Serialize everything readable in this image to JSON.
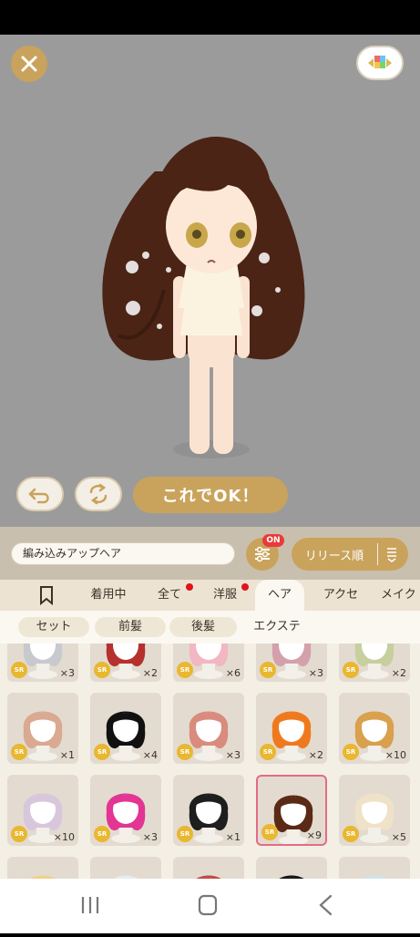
{
  "search": {
    "value": "編み込みアップヘア"
  },
  "filter": {
    "badge": "ON"
  },
  "sort": {
    "label": "リリース順"
  },
  "ok_button": {
    "label": "これでOK！"
  },
  "tabs": [
    {
      "label": "着用中"
    },
    {
      "label": "全て"
    },
    {
      "label": "洋服"
    },
    {
      "label": "ヘア"
    },
    {
      "label": "アクセ"
    },
    {
      "label": "メイク"
    }
  ],
  "subtabs": [
    {
      "label": "セット"
    },
    {
      "label": "前髪"
    },
    {
      "label": "後髪"
    },
    {
      "label": "エクステ"
    }
  ],
  "items": [
    {
      "rarity": "SR",
      "count": "×3",
      "color": "#c7c9cf"
    },
    {
      "rarity": "SR",
      "count": "×2",
      "color": "#b5312f"
    },
    {
      "rarity": "SR",
      "count": "×6",
      "color": "#f2b7c2"
    },
    {
      "rarity": "SR",
      "count": "×3",
      "color": "#d4a0ab"
    },
    {
      "rarity": "SR",
      "count": "×2",
      "color": "#c7cf9e"
    },
    {
      "rarity": "SR",
      "count": "×1",
      "color": "#d9a991"
    },
    {
      "rarity": "SR",
      "count": "×4",
      "color": "#111111"
    },
    {
      "rarity": "SR",
      "count": "×3",
      "color": "#d98c7e"
    },
    {
      "rarity": "SR",
      "count": "×2",
      "color": "#ef7a1e"
    },
    {
      "rarity": "SR",
      "count": "×10",
      "color": "#d9a04e"
    },
    {
      "rarity": "SR",
      "count": "×10",
      "color": "#d8c6dc"
    },
    {
      "rarity": "SR",
      "count": "×3",
      "color": "#e23594"
    },
    {
      "rarity": "SR",
      "count": "×1",
      "color": "#1e1e1e"
    },
    {
      "rarity": "SR",
      "count": "×9",
      "color": "#5a2a16"
    },
    {
      "rarity": "SR",
      "count": "×5",
      "color": "#efe2c8"
    },
    {
      "rarity": "",
      "count": "",
      "color": "#f0d08a"
    },
    {
      "rarity": "",
      "count": "",
      "color": "#e6ecef"
    },
    {
      "rarity": "",
      "count": "",
      "color": "#c24a42"
    },
    {
      "rarity": "",
      "count": "",
      "color": "#151515"
    },
    {
      "rarity": "",
      "count": "",
      "color": "#cfe3ea"
    }
  ],
  "colors": {
    "accent": "#c9a35c",
    "stage_bg": "#9b9b9b",
    "badge_red": "#e83b3b",
    "selected_border": "#e46b86"
  }
}
